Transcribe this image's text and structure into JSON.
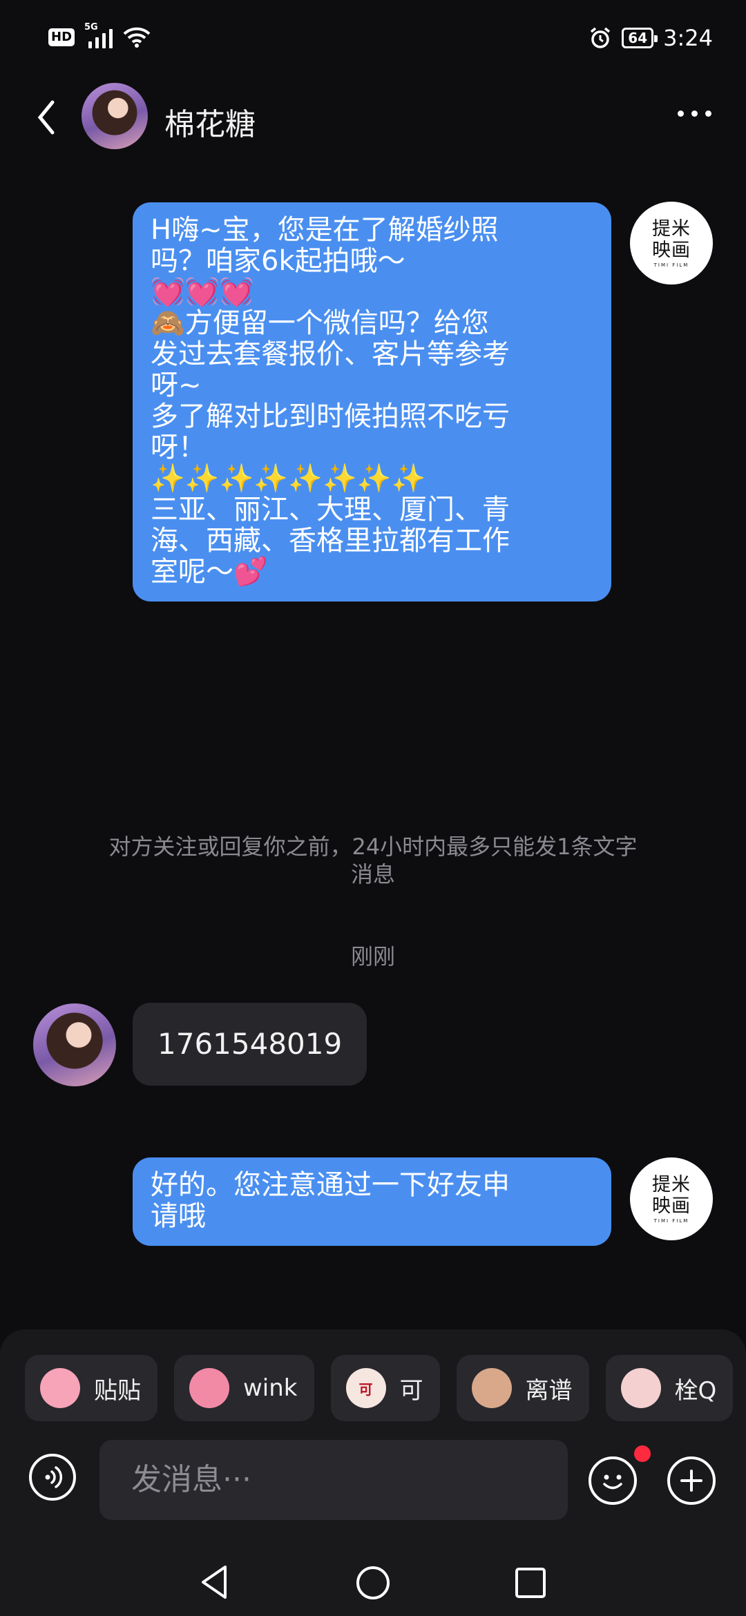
{
  "status_bar": {
    "hd_label": "HD",
    "network_label": "5G",
    "battery_level": "64",
    "time": "3:24"
  },
  "header": {
    "title": "棉花糖"
  },
  "contact_logo": {
    "line1": "提米",
    "line2": "映画",
    "line3": "TIMI FILM"
  },
  "messages": [
    {
      "from": "me",
      "text": "H嗨~宝，您是在了解婚纱照\n吗？咱家6k起拍哦～\n💓💓💓\n🙈方便留一个微信吗？给您\n发过去套餐报价、客片等参考\n呀~\n多了解对比到时候拍照不吃亏\n呀！\n✨✨✨✨✨✨✨✨\n三亚、丽江、大理、厦门、青\n海、西藏、香格里拉都有工作\n室呢～💕"
    },
    {
      "from": "them",
      "text": "1761548019"
    },
    {
      "from": "me",
      "text": "好的。您注意通过一下好友申\n请哦"
    }
  ],
  "notice": "对方关注或回复你之前，24小时内最多只能发1条文字\n消息",
  "timestamp": "刚刚",
  "stickers": [
    {
      "label": "贴贴",
      "icon": "hug-sticker-icon"
    },
    {
      "label": "wink",
      "icon": "wink-sticker-icon"
    },
    {
      "label": "可",
      "icon": "ok-sticker-icon",
      "badge": "可"
    },
    {
      "label": "离谱",
      "icon": "speechless-sticker-icon"
    },
    {
      "label": "栓Q",
      "icon": "thank-you-sticker-icon"
    }
  ],
  "input": {
    "placeholder": "发消息···"
  },
  "colors": {
    "bubble_out": "#4a8ff0",
    "bubble_in": "#26262b",
    "background": "#0d0d10",
    "notification_dot": "#ff2a3d"
  }
}
